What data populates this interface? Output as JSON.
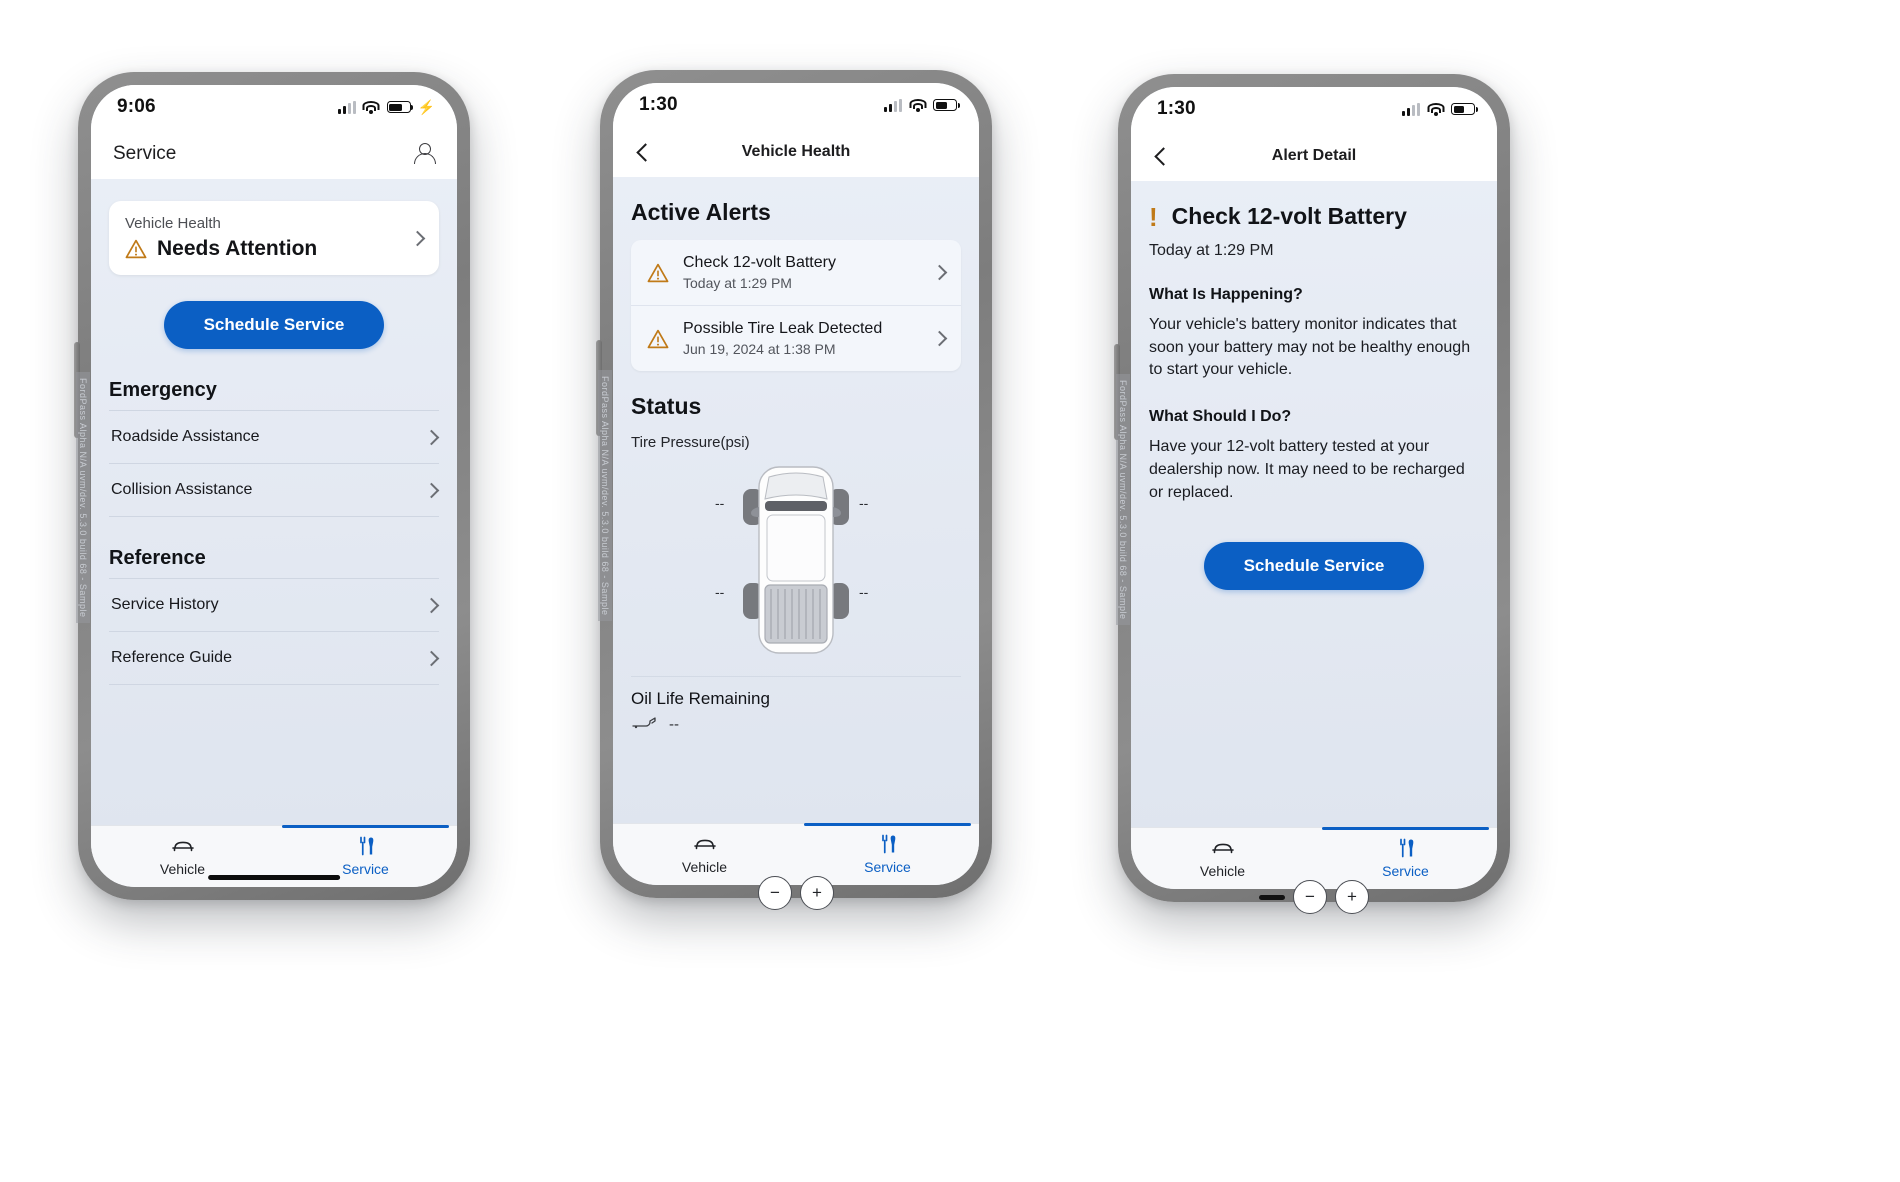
{
  "screen1": {
    "statusbar": {
      "time": "9:06",
      "signal_icon": "signal-bars-icon",
      "wifi_icon": "wifi-icon",
      "battery_icon": "battery-charging-icon"
    },
    "navbar": {
      "title": "Service",
      "profile_icon": "person-icon"
    },
    "health_card": {
      "label": "Vehicle Health",
      "status": "Needs Attention",
      "warning_icon": "warning-triangle-icon",
      "chevron_icon": "chevron-right-icon"
    },
    "primary_button": "Schedule Service",
    "sections": [
      {
        "title": "Emergency",
        "rows": [
          {
            "label": "Roadside Assistance",
            "chevron_icon": "chevron-right-icon"
          },
          {
            "label": "Collision Assistance",
            "chevron_icon": "chevron-right-icon"
          }
        ]
      },
      {
        "title": "Reference",
        "rows": [
          {
            "label": "Service History",
            "chevron_icon": "chevron-right-icon"
          },
          {
            "label": "Reference Guide",
            "chevron_icon": "chevron-right-icon"
          }
        ]
      }
    ],
    "tabs": [
      {
        "label": "Vehicle",
        "icon": "car-icon",
        "active": false
      },
      {
        "label": "Service",
        "icon": "wrench-screwdriver-icon",
        "active": true
      }
    ],
    "watermark": "FordPass Alpha N/A uvm/dev. 5.3.0 build 68 - Sample"
  },
  "screen2": {
    "statusbar": {
      "time": "1:30",
      "signal_icon": "signal-bars-icon",
      "wifi_icon": "wifi-icon",
      "battery_icon": "battery-icon"
    },
    "navbar": {
      "title": "Vehicle Health",
      "back_icon": "chevron-left-icon"
    },
    "alerts_heading": "Active Alerts",
    "alerts": [
      {
        "title": "Check 12-volt Battery",
        "time": "Today at 1:29 PM",
        "warning_icon": "warning-triangle-icon",
        "chevron_icon": "chevron-right-icon"
      },
      {
        "title": "Possible Tire Leak Detected",
        "time": "Jun 19, 2024 at 1:38 PM",
        "warning_icon": "warning-triangle-icon",
        "chevron_icon": "chevron-right-icon"
      }
    ],
    "status_heading": "Status",
    "tire_pressure_label": "Tire Pressure(psi)",
    "tire_values": {
      "front_left": "--",
      "front_right": "--",
      "rear_left": "--",
      "rear_right": "--"
    },
    "vehicle_icon": "vehicle-top-down-icon",
    "oil_life_label": "Oil Life Remaining",
    "oil_icon": "oil-can-icon",
    "oil_value": "--",
    "tabs": [
      {
        "label": "Vehicle",
        "icon": "car-icon",
        "active": false
      },
      {
        "label": "Service",
        "icon": "wrench-screwdriver-icon",
        "active": true
      }
    ],
    "watermark": "FordPass Alpha N/A uvm/dev. 5.3.0 build 68 - Sample"
  },
  "screen3": {
    "statusbar": {
      "time": "1:30",
      "signal_icon": "signal-bars-icon",
      "wifi_icon": "wifi-icon",
      "battery_icon": "battery-icon"
    },
    "navbar": {
      "title": "Alert Detail",
      "back_icon": "chevron-left-icon"
    },
    "alert": {
      "bang_icon": "exclamation-icon",
      "title": "Check 12-volt Battery",
      "time": "Today at 1:29 PM"
    },
    "blocks": [
      {
        "question": "What Is Happening?",
        "answer": "Your vehicle's battery monitor indicates that soon your battery may not be healthy enough to start your vehicle."
      },
      {
        "question": "What Should I Do?",
        "answer": "Have your 12-volt battery tested at your dealership now. It may need to be recharged or replaced."
      }
    ],
    "primary_button": "Schedule Service",
    "tabs": [
      {
        "label": "Vehicle",
        "icon": "car-icon",
        "active": false
      },
      {
        "label": "Service",
        "icon": "wrench-screwdriver-icon",
        "active": true
      }
    ],
    "zoom_controls": {
      "zoom_out": "−",
      "zoom_in": "+"
    },
    "watermark": "FordPass Alpha N/A uvm/dev. 5.3.0 build 68 - Sample"
  },
  "colors": {
    "accent_blue": "#0b5fc4",
    "warning_amber": "#c07a18",
    "screen_bg": "#e7ecf4",
    "bezel": "#838383"
  }
}
